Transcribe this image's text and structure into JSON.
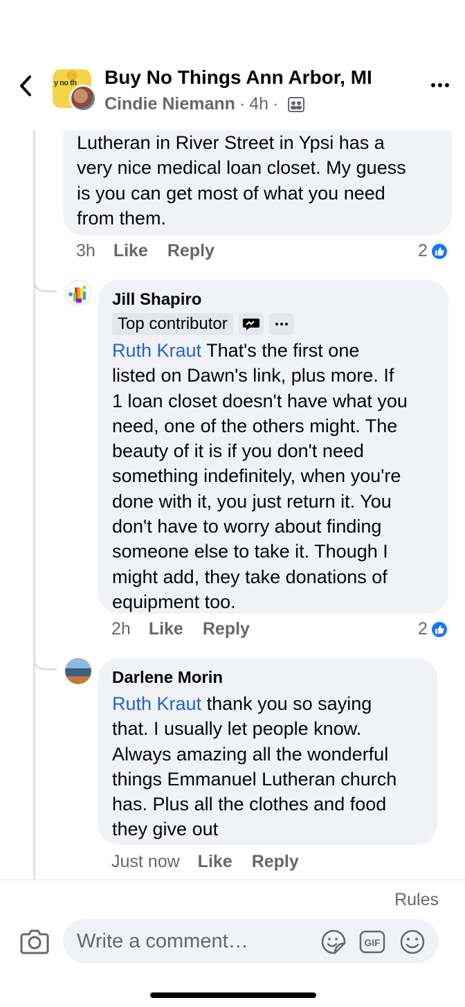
{
  "header": {
    "group_name": "Buy No Things Ann Arbor, MI",
    "author": "Cindie Niemann",
    "separator": "·",
    "time": "4h",
    "separator2": "·",
    "group_avatar_text": "y no th"
  },
  "comments": [
    {
      "text": "Lutheran in River Street in Ypsi has a\nvery nice medical loan closet. My guess\nis you can get most of what you need\nfrom them.",
      "time": "3h",
      "like_label": "Like",
      "reply_label": "Reply",
      "reaction_count": "2"
    },
    {
      "author": "Jill Shapiro",
      "badge": "Top contributor",
      "mention": "Ruth Kraut",
      "text": " That's the first one\nlisted on Dawn's link, plus more.  If\n1 loan closet doesn't have what you\nneed, one of the others might.  The\nbeauty of it is if you don't need\nsomething indefinitely, when you're\ndone with it, you just return it.  You\ndon't have to worry about finding\nsomeone else to take it.  Though I\nmight add, they take donations of\nequipment too.",
      "time": "2h",
      "like_label": "Like",
      "reply_label": "Reply",
      "reaction_count": "2"
    },
    {
      "author": "Darlene Morin",
      "mention": "Ruth Kraut",
      "text": " thank you so saying\nthat. I usually let people know.\nAlways amazing all the wonderful\nthings Emmanuel Lutheran church\nhas. Plus all the clothes and food\nthey give out",
      "time": "Just now",
      "like_label": "Like",
      "reply_label": "Reply"
    }
  ],
  "composer": {
    "rules_label": "Rules",
    "placeholder": "Write a comment…",
    "gif_label": "GIF"
  },
  "colors": {
    "mention": "#2563c9",
    "like_blue": "#1877f2",
    "bubble_bg": "#f0f2f5",
    "secondary_text": "#65676b"
  },
  "icons": [
    "back-chevron-icon",
    "privacy-group-icon",
    "more-icon",
    "like-reaction-icon",
    "messenger-badge-icon",
    "camera-icon",
    "sticker-icon",
    "gif-icon",
    "emoji-icon"
  ]
}
